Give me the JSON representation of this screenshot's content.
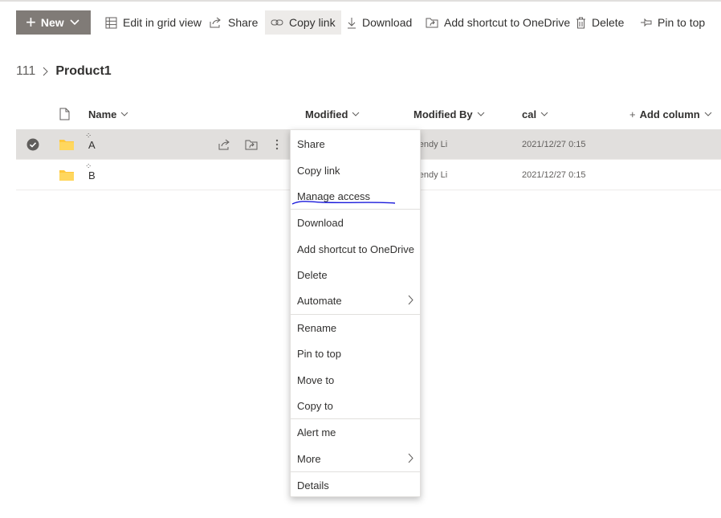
{
  "commandbar": {
    "new_label": "New",
    "edit_grid_label": "Edit in grid view",
    "share_label": "Share",
    "copy_link_label": "Copy link",
    "download_label": "Download",
    "add_shortcut_label": "Add shortcut to OneDrive",
    "delete_label": "Delete",
    "pin_label": "Pin to top"
  },
  "breadcrumb": {
    "root": "111",
    "current": "Product1"
  },
  "columns": {
    "name": "Name",
    "modified": "Modified",
    "modified_by": "Modified By",
    "cal": "cal",
    "add_column": "Add column"
  },
  "rows": [
    {
      "name": "A",
      "modified_by": "Vendy Li",
      "cal": "2021/12/27 0:15",
      "selected": true
    },
    {
      "name": "B",
      "modified_by": "Vendy Li",
      "cal": "2021/12/27 0:15",
      "selected": false
    }
  ],
  "context_menu": {
    "items": [
      "Share",
      "Copy link",
      "Manage access",
      "Download",
      "Add shortcut to OneDrive",
      "Delete",
      "Automate",
      "Rename",
      "Pin to top",
      "Move to",
      "Copy to",
      "Alert me",
      "More",
      "Details"
    ],
    "highlighted_item": "Manage access"
  },
  "colors": {
    "new_button": "#807b77",
    "selected_row": "#e1dfdd",
    "folder": "#ffc83d",
    "annotation": "#1a1adb"
  },
  "icons": [
    "plus-icon",
    "chevron-down-icon",
    "grid-icon",
    "share-icon",
    "link-icon",
    "download-icon",
    "shortcut-icon",
    "delete-icon",
    "pin-icon",
    "document-icon",
    "folder-icon",
    "check-icon",
    "more-icon",
    "chevron-right-icon"
  ]
}
